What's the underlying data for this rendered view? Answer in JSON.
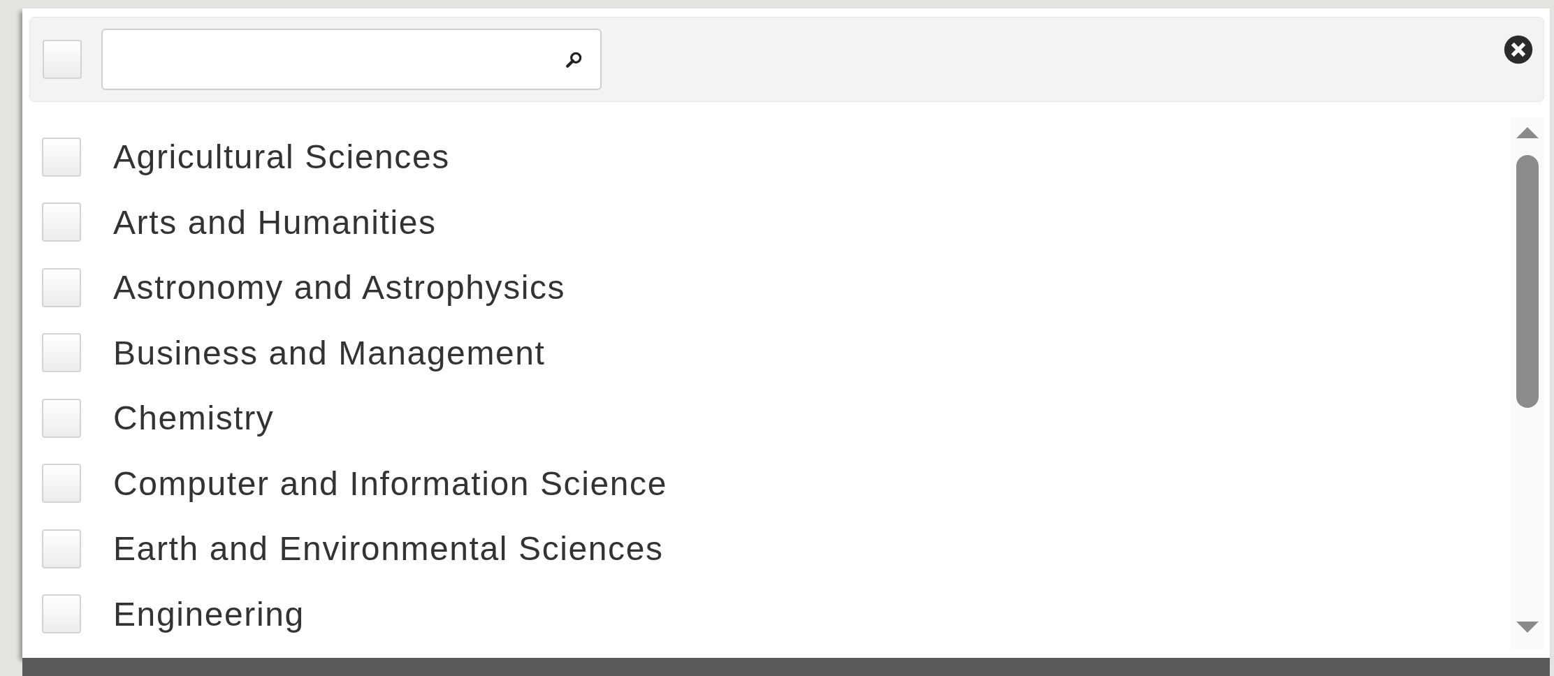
{
  "header": {
    "select_all": {
      "checked": false
    }
  },
  "options": [
    {
      "label": "Agricultural Sciences",
      "checked": false
    },
    {
      "label": "Arts and Humanities",
      "checked": false
    },
    {
      "label": "Astronomy and Astrophysics",
      "checked": false
    },
    {
      "label": "Business and Management",
      "checked": false
    },
    {
      "label": "Chemistry",
      "checked": false
    },
    {
      "label": "Computer and Information Science",
      "checked": false
    },
    {
      "label": "Earth and Environmental Sciences",
      "checked": false
    },
    {
      "label": "Engineering",
      "checked": false
    }
  ]
}
